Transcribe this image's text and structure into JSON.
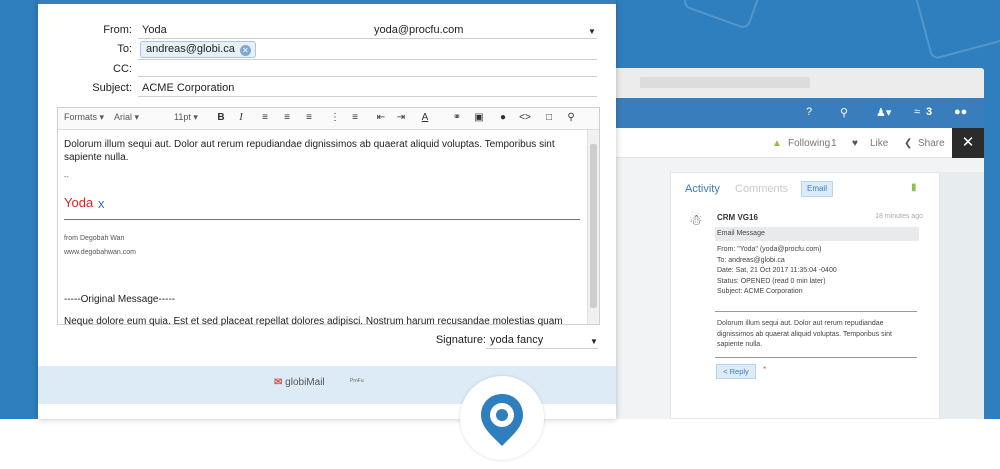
{
  "compose": {
    "from_label": "From:",
    "from_name": "Yoda",
    "from_email": "yoda@procfu.com",
    "to_label": "To:",
    "to_recipient": "andreas@globi.ca",
    "cc_label": "CC:",
    "subject_label": "Subject:",
    "subject_value": "ACME Corporation",
    "toolbar": {
      "formats": "Formats",
      "font": "Arial",
      "size": "11pt",
      "bold": "B",
      "italic": "I"
    },
    "body": {
      "paragraph": "Dolorum illum sequi aut. Dolor aut rerum repudiandae dignissimos ab quaerat aliquid voluptas. Temporibus sint sapiente nulla.",
      "dashes": "--",
      "sig_name": "Yoda",
      "sig_x": "x",
      "sig_from": "from Degobah Wan",
      "sig_site": "www.degobahwan.com",
      "original_header": "-----Original Message-----",
      "original_body": "Neque dolore eum quia. Est et sed placeat repellat dolores adipisci. Nostrum harum recusandae molestias quam"
    },
    "signature_label": "Signature:",
    "signature_value": "yoda fancy",
    "footer_logo": "globiMail",
    "footer_logo_small": "ProFu"
  },
  "crm": {
    "nav_question": "?",
    "nav_count": "3",
    "following_label": "Following",
    "following_count": "1",
    "like_label": "Like",
    "share_label": "Share",
    "close": "✕",
    "tab_activity": "Activity",
    "tab_comments": "Comments",
    "tab_email": "Email",
    "entry_name": "CRM VG16",
    "entry_time": "18 minutes ago",
    "entry_subject": "Email Message",
    "entry_from": "From: \"Yoda\" (yoda@procfu.com)",
    "entry_to": "To: andreas@globi.ca",
    "entry_date": "Date: Sat, 21 Oct 2017 11:35:04 -0400",
    "entry_status": "Status: OPENED (read 0 min later)",
    "entry_subj_line": "Subject: ACME Corporation",
    "entry_body": "Dolorum illum sequi aut. Dolor aut rerum repudiandae dignissimos ab quaerat aliquid voluptas. Temporibus sint sapiente nulla.",
    "reply": "< Reply",
    "reply_star": "*"
  },
  "colors": {
    "brand_blue": "#2f7fbe",
    "signature_red": "#e02020"
  }
}
